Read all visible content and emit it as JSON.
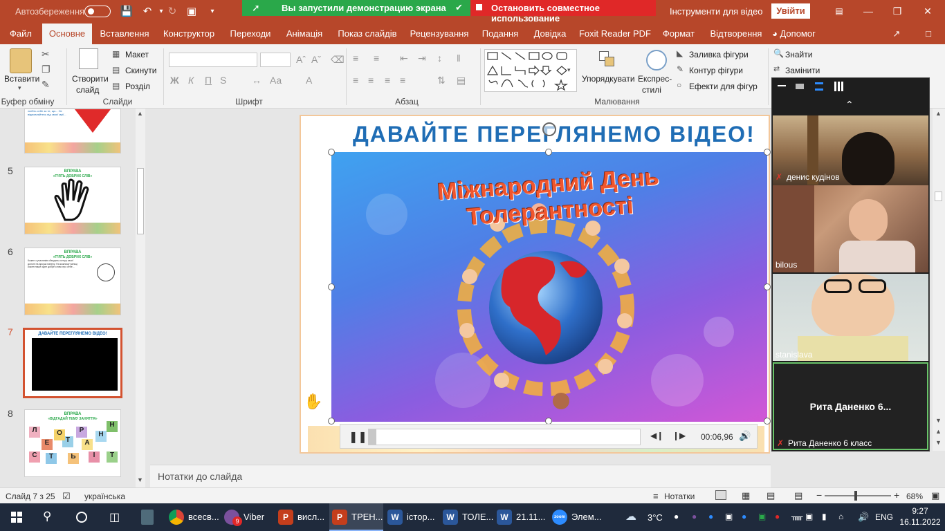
{
  "titlebar": {
    "autosave_label": "Автозбереження",
    "share_notice": "Вы запустили демонстрацию экрана",
    "stop_share": "Остановить совместное использование",
    "tools_title": "Інструменти для відео",
    "enter_button": "Увійти"
  },
  "tabs": [
    "Файл",
    "Основне",
    "Вставлення",
    "Конструктор",
    "Переходи",
    "Анімація",
    "Показ слайдів",
    "Рецензування",
    "Подання",
    "Довідка",
    "Foxit Reader PDF",
    "Формат",
    "Відтворення"
  ],
  "tabs_help": "Допомог",
  "ribbon": {
    "paste": "Вставити",
    "create_slide": "Створити",
    "create_slide2": "слайд",
    "layout": "Макет",
    "reset": "Скинути",
    "section": "Розділ",
    "bold": "Ж",
    "italic": "К",
    "underline": "П",
    "strike": "S",
    "aa": "Aa",
    "arrange": "Упорядкувати",
    "quick_styles": "Експрес-",
    "quick_styles2": "стилі",
    "fill": "Заливка фігури",
    "outline": "Контур фігури",
    "effects": "Ефекти для фігур",
    "find": "Знайти",
    "replace": "Замінити",
    "groups": {
      "clipboard": "Буфер обміну",
      "slides": "Слайди",
      "font": "Шрифт",
      "paragraph": "Абзац",
      "drawing": "Малювання"
    }
  },
  "thumbnails": {
    "slide4_text": "любіть себе за те, що... Не відмовляйтесь від своєї мрії...",
    "slide5_caption1": "ВПРАВА",
    "slide5_caption2": "«П'ЯТЬ ДОБРИХ СЛІВ»",
    "slide6_caption1": "ВПРАВА",
    "slide6_caption2": "«П'ЯТЬ ДОБРИХ СЛІВ»",
    "slide6_text": "Кожен з учасників обводить контур своєї долоні на аркуші паперу. На кожному пальці кожен пише одне добре слово про себе...",
    "slide7_title": "ДАВАЙТЕ ПЕРЕГЛЯНЕМО ВІДЕО!",
    "slide8_caption1": "ВПРАВА",
    "slide8_caption2": "«ВІДГАДАЙ ТЕМУ ЗАНЯТТЯ»",
    "slide8_letters": [
      "Н",
      "Л",
      "Е",
      "Т",
      "О",
      "Р",
      "А",
      "Н",
      "С",
      "Т",
      "Ь",
      "І",
      "Т"
    ],
    "numbers": [
      "5",
      "6",
      "7",
      "8"
    ]
  },
  "slide": {
    "title": "ДАВАЙТЕ ПЕРЕГЛЯНЕМО ВІДЕО!",
    "video_title": "Міжнародний День Толерантності",
    "time": "00:06,96",
    "video_progress": 0.027
  },
  "notes_placeholder": "Нотатки до слайда",
  "zoom": {
    "participants": [
      {
        "name": "денис кудінов",
        "muted": true
      },
      {
        "name": "bilous",
        "muted": false
      },
      {
        "name": "stanislava",
        "muted": false
      },
      {
        "name": "Рита Даненко 6 класс",
        "muted": true
      }
    ],
    "center_name": "Рита Даненко 6..."
  },
  "statusbar": {
    "slide_info": "Слайд 7 з 25",
    "language": "українська",
    "notes_btn": "Нотатки",
    "zoom_level": "68%",
    "zoom_fraction": 0.45
  },
  "taskbar": {
    "items": [
      {
        "label": "всесв...",
        "icon": "chrome-icon",
        "color": "#2a8a3a"
      },
      {
        "label": "Viber",
        "icon": "viber-icon",
        "color": "#7b519d",
        "badge": "9"
      },
      {
        "label": "висл...",
        "icon": "powerpoint-icon",
        "color": "#c43e1c"
      },
      {
        "label": "ТРЕН...",
        "icon": "powerpoint-icon",
        "color": "#c43e1c"
      },
      {
        "label": "істор...",
        "icon": "word-icon",
        "color": "#2b579a"
      },
      {
        "label": "ТОЛЕ...",
        "icon": "word-icon",
        "color": "#2b579a"
      },
      {
        "label": "21.11...",
        "icon": "word-icon",
        "color": "#2b579a"
      },
      {
        "label": "Элем...",
        "icon": "zoom-icon",
        "color": "#2d8cff"
      }
    ],
    "weather": "3°C",
    "lang": "ENG",
    "time": "9:27",
    "date": "16.11.2022"
  },
  "colors": {
    "ppt_accent": "#b7472a",
    "share_green": "#2aa84a",
    "share_red": "#e02828",
    "slide_title": "#1f6db5"
  }
}
